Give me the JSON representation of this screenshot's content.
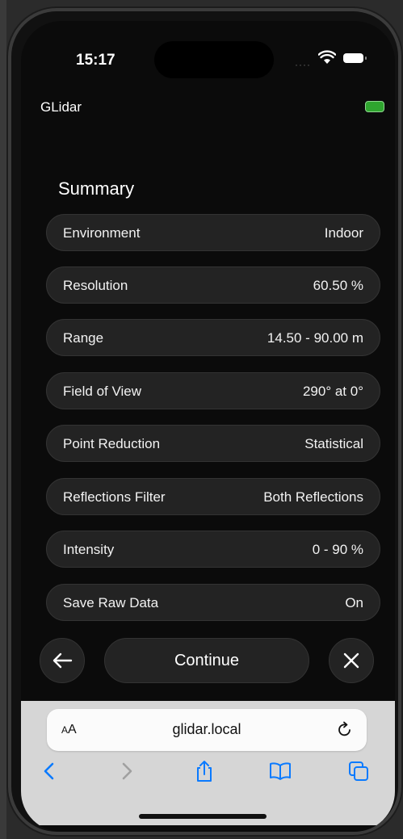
{
  "status": {
    "time": "15:17",
    "cell_dots": "····"
  },
  "app": {
    "title": "GLidar"
  },
  "summary": {
    "title": "Summary",
    "rows": [
      {
        "label": "Environment",
        "value": "Indoor"
      },
      {
        "label": "Resolution",
        "value": "60.50 %"
      },
      {
        "label": "Range",
        "value": "14.50 - 90.00 m"
      },
      {
        "label": "Field of View",
        "value": "290° at 0°"
      },
      {
        "label": "Point Reduction",
        "value": "Statistical"
      },
      {
        "label": "Reflections Filter",
        "value": "Both Reflections"
      },
      {
        "label": "Intensity",
        "value": "0 - 90 %"
      },
      {
        "label": "Save Raw Data",
        "value": "On"
      }
    ]
  },
  "nav": {
    "continue_label": "Continue"
  },
  "browser": {
    "aa_label_big": "A",
    "aa_label_small": "A",
    "url": "glidar.local"
  },
  "colors": {
    "connected": "#2fa52f",
    "accent_blue": "#0a7aff",
    "disabled_gray": "#a0a0a0"
  },
  "icons": {
    "back": "arrow-left-icon",
    "close": "close-icon",
    "reload": "reload-icon",
    "tab_back": "chevron-left-icon",
    "tab_forward": "chevron-right-icon",
    "share": "share-icon",
    "bookmarks": "book-icon",
    "tabs": "tabs-icon"
  }
}
